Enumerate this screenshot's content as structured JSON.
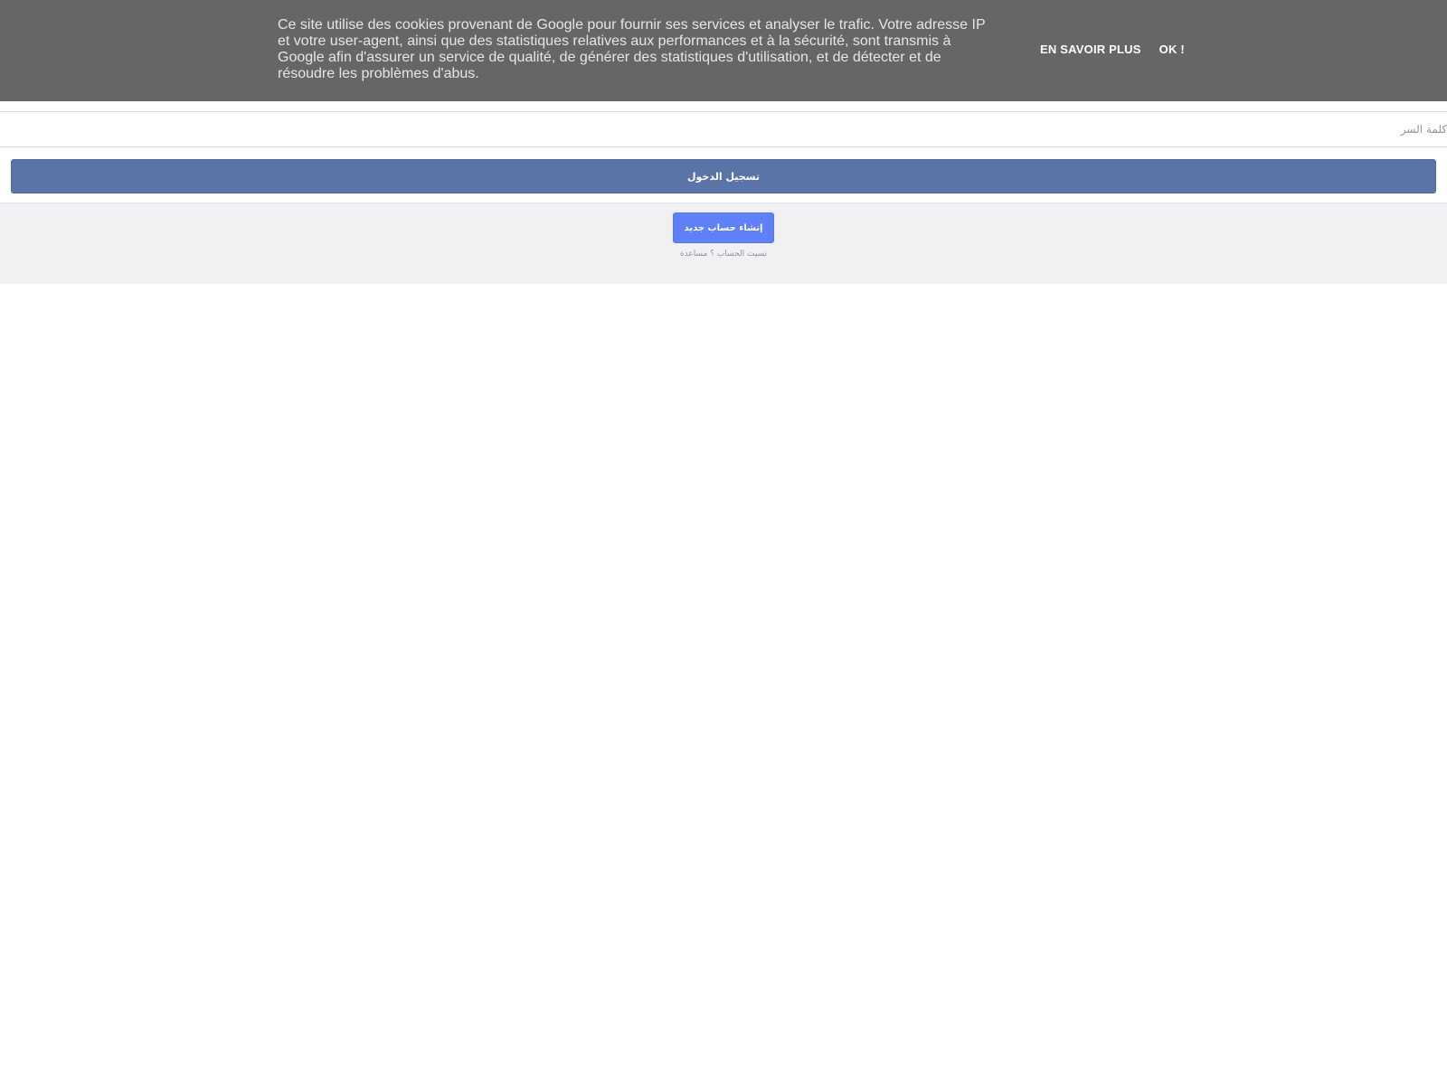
{
  "cookie_banner": {
    "text": "Ce site utilise des cookies provenant de Google pour fournir ses services et analyser le trafic. Votre adresse IP et votre user-agent, ainsi que des statistiques relatives aux performances et à la sécurité, sont transmis à Google afin d'assurer un service de qualité, de générer des statistiques d'utilisation, et de détecter et de résoudre les problèmes d'abus.",
    "learn_more_label": "EN SAVOIR PLUS",
    "ok_label": "OK !",
    "background_color": "#666666"
  },
  "login_form": {
    "password_placeholder": "كلمة السر",
    "login_button_label": "تسجيل الدخول",
    "login_button_color": "#5b74a8"
  },
  "footer": {
    "create_account_label": "إنشاء حساب جديد",
    "create_account_color": "#5f80f6",
    "forgot_account_label": "نسيت الحساب",
    "separator": "؟",
    "help_label": "مساعدة"
  }
}
